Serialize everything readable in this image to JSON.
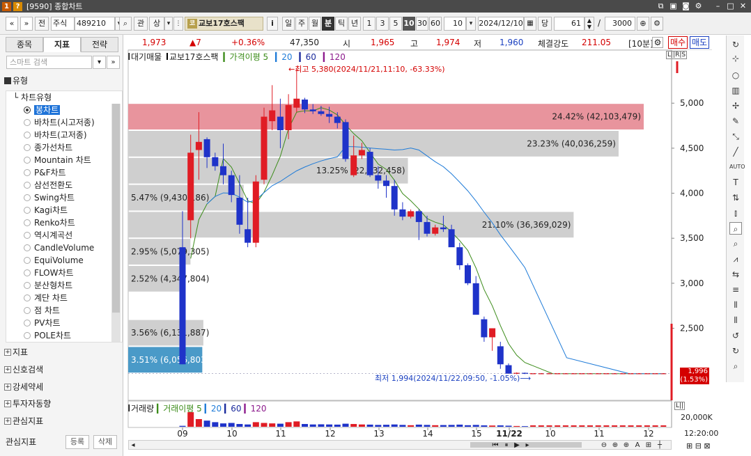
{
  "window": {
    "title": "[9590] 종합차트",
    "icon1": "1",
    "icon2": "?"
  },
  "toolbar": {
    "nav_left": "«",
    "nav_down": "»",
    "jeon": "전",
    "market": "주식",
    "code": "489210",
    "search_icon": "⌕",
    "gwan": "관",
    "sang": "상",
    "stock_badge_icon": "코",
    "stock_name": "교보17호스팩",
    "info": "i",
    "periods": [
      "일",
      "주",
      "월",
      "분",
      "틱",
      "년"
    ],
    "minutes": [
      "1",
      "3",
      "5",
      "10",
      "30",
      "60"
    ],
    "interval_value": "10",
    "date": "2024/12/10",
    "dang": "당",
    "count": "61",
    "slash": "/",
    "total": "3000"
  },
  "left": {
    "tabs": [
      "종목",
      "지표",
      "전략"
    ],
    "search_placeholder": "스마트 검색",
    "section_type": "유형",
    "tree_head": "차트유형",
    "chart_types": [
      "봉차트",
      "바차트(시고저종)",
      "바차트(고저종)",
      "종가선차트",
      "Mountain 차트",
      "P&F차트",
      "삼선전환도",
      "Swing차트",
      "Kagi차트",
      "Renko차트",
      "역시계곡선",
      "CandleVolume",
      "EquiVolume",
      "FLOW차트",
      "분산형차트",
      "계단 차트",
      "점 차트",
      "PV차트",
      "POLE차트"
    ],
    "sections": [
      "지표",
      "신호검색",
      "강세약세",
      "투자자동향",
      "관심지표"
    ],
    "bottom_label": "관심지표",
    "btn_register": "등록",
    "btn_delete": "삭제"
  },
  "quote": {
    "price": "1,973",
    "change": "▲7",
    "rate": "+0.36%",
    "volume": "47,350",
    "open_label": "시",
    "open": "1,965",
    "high_label": "고",
    "high": "1,974",
    "low_label": "저",
    "low": "1,960",
    "strength_label": "체결강도",
    "strength": "211.05",
    "interval": "[10분]",
    "buy": "매수",
    "sell": "매도"
  },
  "legend": {
    "main": "대기매물",
    "stock": "교보17호스팩",
    "ma_label": "가격이평 5",
    "ma20": "20",
    "ma60": "60",
    "ma120": "120",
    "vol_main": "거래량",
    "vol_ma": "거래이평 5",
    "vol20": "20",
    "vol60": "60",
    "vol120": "120",
    "lr": "L||R|S",
    "lr2": "L||"
  },
  "annotations": {
    "high": "←최고 5,380(2024/11/21,11:10, -63.33%)",
    "low": "최저 1,994(2024/11/22,09:50, -1.05%)⟶",
    "current_price": "1,996",
    "current_rate": "(1.53%)"
  },
  "right_axis": {
    "y_labels": [
      "5,000",
      "4,500",
      "4,000",
      "3,500",
      "3,000",
      "2,500"
    ],
    "volume_label": "20,000K"
  },
  "x_axis": {
    "labels": [
      "09",
      "10",
      "11",
      "12",
      "13",
      "14",
      "15",
      "11/22",
      "10",
      "11",
      "12"
    ],
    "time": "12:20:00"
  },
  "chart_data": {
    "type": "candlestick",
    "ylim": [
      1700,
      5450
    ],
    "supply_bars": [
      {
        "label": "24.42% (42,103,479)",
        "from": 4700,
        "to": 5000,
        "pct": 24.42,
        "highlight": true
      },
      {
        "label": "23.23% (40,036,259)",
        "from": 4400,
        "to": 4700,
        "pct": 23.23
      },
      {
        "label": "13.25% (22,832,458)",
        "from": 4100,
        "to": 4400,
        "pct": 13.25
      },
      {
        "label": "5.47% (9,430,186)",
        "from": 3800,
        "to": 4100,
        "pct": 5.47
      },
      {
        "label": "21.10% (36,369,029)",
        "from": 3500,
        "to": 3800,
        "pct": 21.1
      },
      {
        "label": "2.95% (5,079,305)",
        "from": 3200,
        "to": 3500,
        "pct": 2.95
      },
      {
        "label": "2.52% (4,347,804)",
        "from": 2900,
        "to": 3200,
        "pct": 2.52
      },
      {
        "label": "3.56% (6,131,887)",
        "from": 2300,
        "to": 2600,
        "pct": 3.56
      },
      {
        "label": "3.51% (6,056,803)",
        "from": 2000,
        "to": 2300,
        "pct": 3.51,
        "current": true
      }
    ],
    "candles": [
      [
        3400,
        3800,
        2100,
        2100
      ],
      [
        3700,
        4650,
        3500,
        4450
      ],
      [
        4480,
        4900,
        4150,
        4570
      ],
      [
        4600,
        4620,
        4280,
        4400
      ],
      [
        4400,
        4450,
        4250,
        4300
      ],
      [
        4300,
        4550,
        4100,
        4200
      ],
      [
        4200,
        4250,
        3900,
        3980
      ],
      [
        3950,
        4200,
        3550,
        3650
      ],
      [
        3600,
        3950,
        3400,
        3450
      ],
      [
        3450,
        4200,
        3400,
        4130
      ],
      [
        4150,
        4950,
        4100,
        4850
      ],
      [
        4800,
        5200,
        4700,
        4920
      ],
      [
        4850,
        5050,
        4500,
        4700
      ],
      [
        4700,
        5100,
        4600,
        4980
      ],
      [
        4950,
        5380,
        4900,
        5050
      ],
      [
        5040,
        5060,
        4890,
        4930
      ],
      [
        4930,
        4990,
        4880,
        4910
      ],
      [
        4910,
        4970,
        4860,
        4880
      ],
      [
        4880,
        4960,
        4780,
        4850
      ],
      [
        4850,
        4900,
        4720,
        4780
      ],
      [
        4790,
        4820,
        4350,
        4380
      ],
      [
        4200,
        4640,
        4180,
        4420
      ],
      [
        4420,
        4560,
        4380,
        4480
      ],
      [
        4460,
        4500,
        4180,
        4200
      ],
      [
        4200,
        4300,
        4050,
        4140
      ],
      [
        4140,
        4200,
        3950,
        4080
      ],
      [
        4080,
        4150,
        3750,
        3820
      ],
      [
        3820,
        3900,
        3700,
        3740
      ],
      [
        3740,
        3820,
        3720,
        3800
      ],
      [
        3800,
        3820,
        3480,
        3680
      ],
      [
        3680,
        3750,
        3520,
        3550
      ],
      [
        3550,
        3650,
        3530,
        3620
      ],
      [
        3620,
        3750,
        3570,
        3600
      ],
      [
        3600,
        3650,
        3420,
        3400
      ],
      [
        3400,
        3450,
        3150,
        3200
      ],
      [
        3200,
        3220,
        2980,
        3000
      ],
      [
        3000,
        3080,
        2700,
        2650
      ],
      [
        2600,
        2630,
        2350,
        2400
      ],
      [
        2400,
        2500,
        2250,
        2500
      ],
      [
        2300,
        2350,
        2050,
        2100
      ],
      [
        2090,
        2110,
        1994,
        1996
      ],
      [
        1996,
        2010,
        1990,
        2005
      ],
      [
        2005,
        2008,
        1992,
        1998
      ]
    ],
    "flat_until_end": 1996,
    "volume": [
      6,
      95,
      50,
      40,
      30,
      22,
      25,
      18,
      15,
      30,
      25,
      22,
      20,
      30,
      35,
      18,
      15,
      16,
      15,
      14,
      20,
      18,
      15,
      14,
      12,
      13,
      15,
      12,
      10,
      14,
      12,
      10,
      11,
      12,
      14,
      10,
      12,
      9,
      8,
      9,
      7,
      5,
      4
    ]
  }
}
